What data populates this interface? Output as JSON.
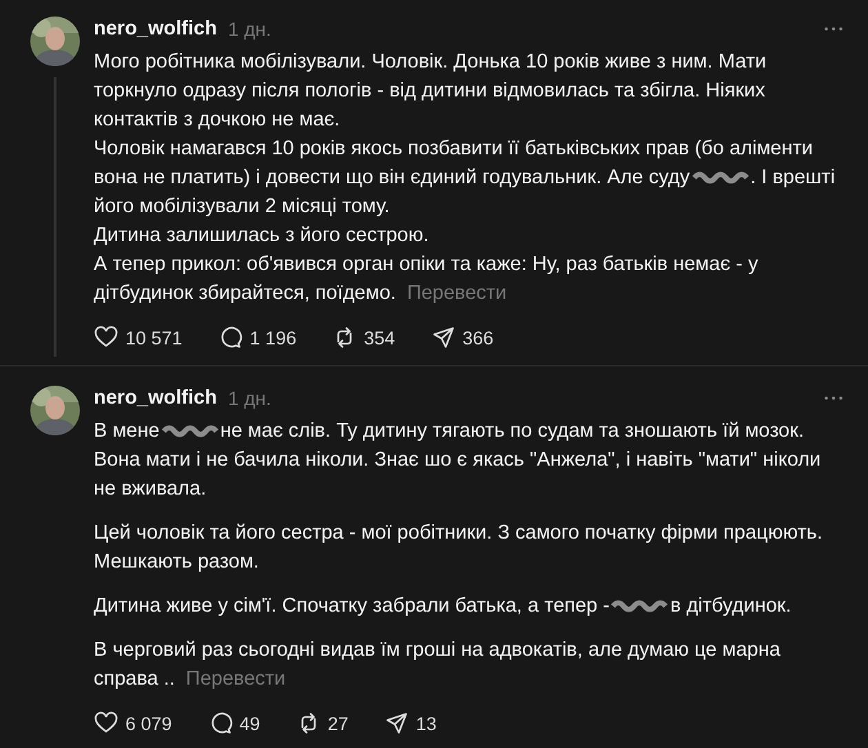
{
  "posts": [
    {
      "username": "nero_wolfich",
      "time": "1 дн.",
      "kind": "lines",
      "thread_line": true,
      "paragraphs": [
        [
          {
            "kind": "text",
            "text": "Мого робітника мобілізували. Чоловік. Донька 10 років живе з ним. Мати торкнуло одразу після пологів - від дитини відмовилась та збігла. Ніяких контактів з дочкою не має."
          }
        ],
        [
          {
            "kind": "text",
            "text": "Чоловік намагався 10 років якось позбавити її батьківських прав (бо аліменти вона не платить) і довести що він єдиний годувальник. Але суду"
          },
          {
            "kind": "redacted"
          },
          {
            "kind": "text",
            "text": ". І врешті його мобілізували 2 місяці тому."
          }
        ],
        [
          {
            "kind": "text",
            "text": "Дитина залишилась з його сестрою."
          }
        ],
        [
          {
            "kind": "text",
            "text": "А тепер прикол: об'явився орган опіки та каже: Ну, раз батьків немає - у дітбудинок збирайтеся, поїдемо."
          }
        ]
      ],
      "translate": "Перевести",
      "stats": {
        "likes": "10 571",
        "replies": "1 196",
        "reposts": "354",
        "shares": "366"
      }
    },
    {
      "username": "nero_wolfich",
      "time": "1 дн.",
      "kind": "paragraphs",
      "thread_line": false,
      "paragraphs": [
        [
          {
            "kind": "text",
            "text": "В мене"
          },
          {
            "kind": "redacted"
          },
          {
            "kind": "text",
            "text": "не має слів. Ту дитину тягають по судам та зношають їй мозок. Вона мати і не бачила ніколи. Знає шо є якась \"Анжела\", і навіть \"мати\" ніколи не вживала."
          }
        ],
        [
          {
            "kind": "text",
            "text": "Цей чоловік та його сестра - мої робітники. З самого початку фірми працюють. Мешкають разом."
          }
        ],
        [
          {
            "kind": "text",
            "text": "Дитина живе у сім'ї. Спочатку забрали батька, а тепер -"
          },
          {
            "kind": "redacted"
          },
          {
            "kind": "text",
            "text": "в дітбудинок."
          }
        ],
        [
          {
            "kind": "text",
            "text": "В черговий раз сьогодні видав їм гроші на адвокатів, але думаю це марна справа .."
          }
        ]
      ],
      "translate": "Перевести",
      "stats": {
        "likes": "6 079",
        "replies": "49",
        "reposts": "27",
        "shares": "13"
      }
    }
  ]
}
